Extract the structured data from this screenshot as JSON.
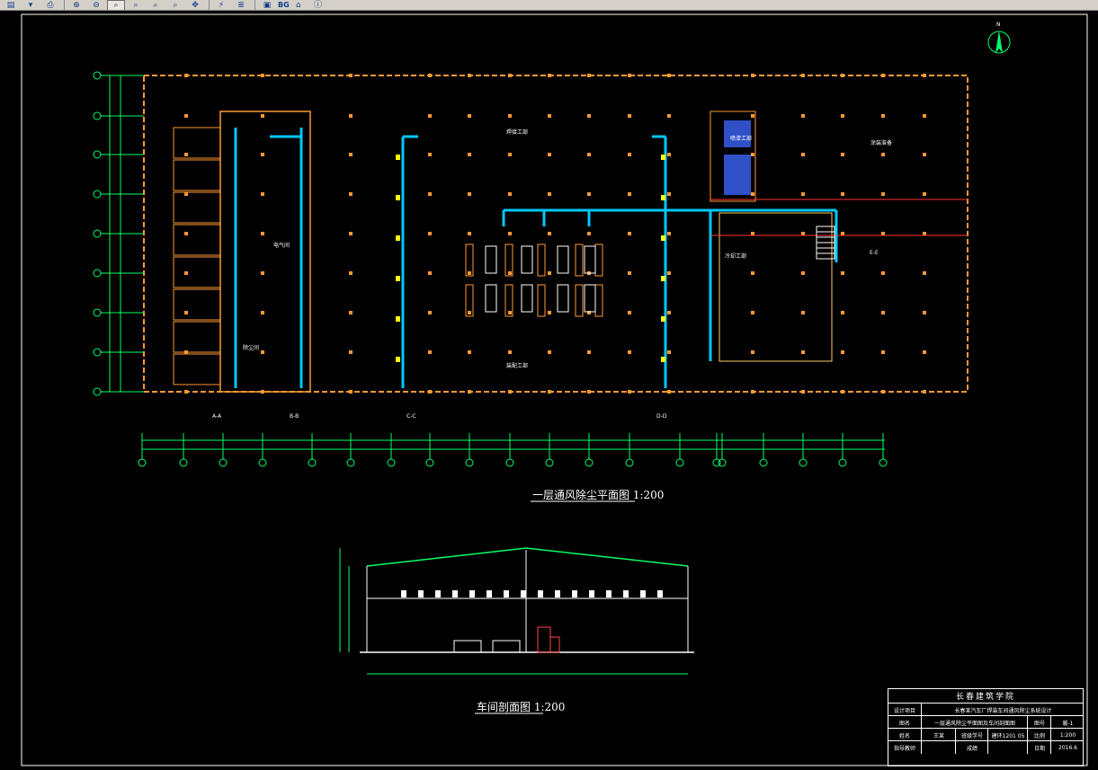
{
  "toolbar": {
    "buttons": [
      {
        "icon": "menu-icon",
        "glyph": "▤"
      },
      {
        "icon": "dropdown-icon",
        "glyph": "▾"
      },
      {
        "icon": "print-icon",
        "glyph": "⎙"
      },
      {
        "icon": "zoom-in-icon",
        "glyph": "⊕"
      },
      {
        "icon": "zoom-out-icon",
        "glyph": "⊖"
      },
      {
        "icon": "zoom-window-icon",
        "glyph": "⌕"
      },
      {
        "icon": "zoom-realtime-icon",
        "glyph": "⌕"
      },
      {
        "icon": "zoom-previous-icon",
        "glyph": "⌕"
      },
      {
        "icon": "zoom-extents-icon",
        "glyph": "⌕"
      },
      {
        "icon": "pan-icon",
        "glyph": "✥"
      },
      {
        "icon": "measure-icon",
        "glyph": "⚡"
      },
      {
        "icon": "layer-icon",
        "glyph": "≣"
      },
      {
        "icon": "window-icon",
        "glyph": "▣"
      },
      {
        "icon": "home-icon",
        "glyph": "⌂"
      },
      {
        "icon": "info-icon",
        "glyph": "ⓘ"
      }
    ],
    "bg_label": "BG"
  },
  "drawing": {
    "north_label": "N",
    "plan_title": "一层通风除尘平面图 1:200",
    "section_title": "车间剖面图 1:200",
    "room_labels": [
      "电气间",
      "焊接工部",
      "装配工部",
      "涂装准备",
      "冷却工部",
      "喷漆工部",
      "除尘间"
    ],
    "section_labels": [
      "A-A",
      "B-B",
      "C-C",
      "D-D",
      "E-E"
    ],
    "colors": {
      "grid": "#00ff66",
      "wall": "#ff9933",
      "duct": "#00c8ff",
      "text": "#ffff00",
      "line": "#ffffff"
    }
  },
  "title_block": {
    "school": "长春建筑学院",
    "project_label": "设计项目",
    "project_value": "长春某汽车厂焊装车间通风除尘系统设计",
    "drawing_label": "图名",
    "drawing_value": "一层通风除尘平面图及车间剖面图",
    "sheet_label": "图号",
    "sheet_value": "暖-1",
    "name_label": "姓名",
    "name_value": "王某",
    "class_label": "班级学号",
    "class_value": "建环1201 05",
    "scale_label": "比例",
    "scale_value": "1:200",
    "advisor_label": "指导教师",
    "grade_label": "成绩",
    "date_label": "日期",
    "date_value": "2016.6"
  }
}
